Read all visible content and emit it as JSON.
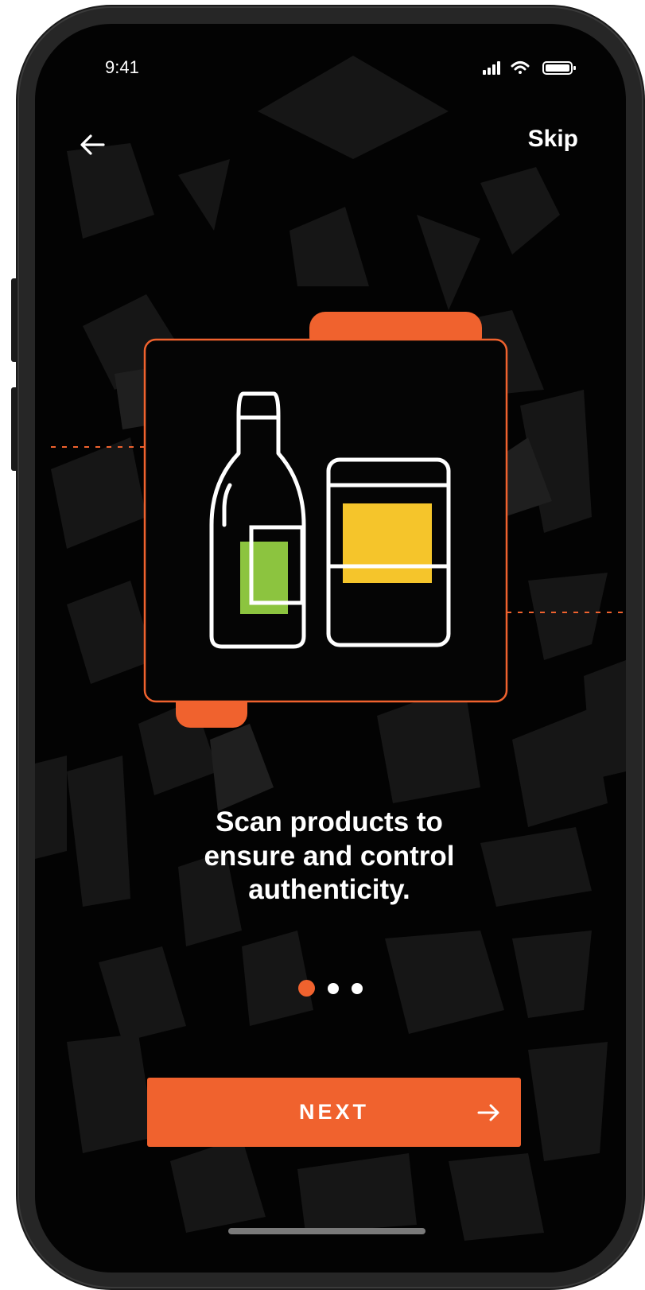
{
  "status_bar": {
    "time": "9:41",
    "icons": [
      "cellular-signal-icon",
      "wifi-icon",
      "battery-icon"
    ]
  },
  "nav": {
    "back_icon": "arrow-left-icon",
    "skip_label": "Skip"
  },
  "illustration": {
    "items": [
      "bottle-icon",
      "jar-icon"
    ],
    "colors": {
      "frame": "#f0622e",
      "bottle_label": "#8cc43f",
      "jar_label": "#f5c52b",
      "outline": "#ffffff"
    }
  },
  "onboarding": {
    "headline_lines": [
      "Scan products to",
      "ensure and control",
      "authenticity."
    ],
    "pages": [
      {
        "state": "active"
      },
      {
        "state": "inactive"
      },
      {
        "state": "inactive"
      }
    ]
  },
  "next_button": {
    "label": "NEXT",
    "icon": "arrow-right-icon"
  },
  "theme": {
    "accent": "#f0622e",
    "background": "#030303",
    "text": "#ffffff"
  }
}
